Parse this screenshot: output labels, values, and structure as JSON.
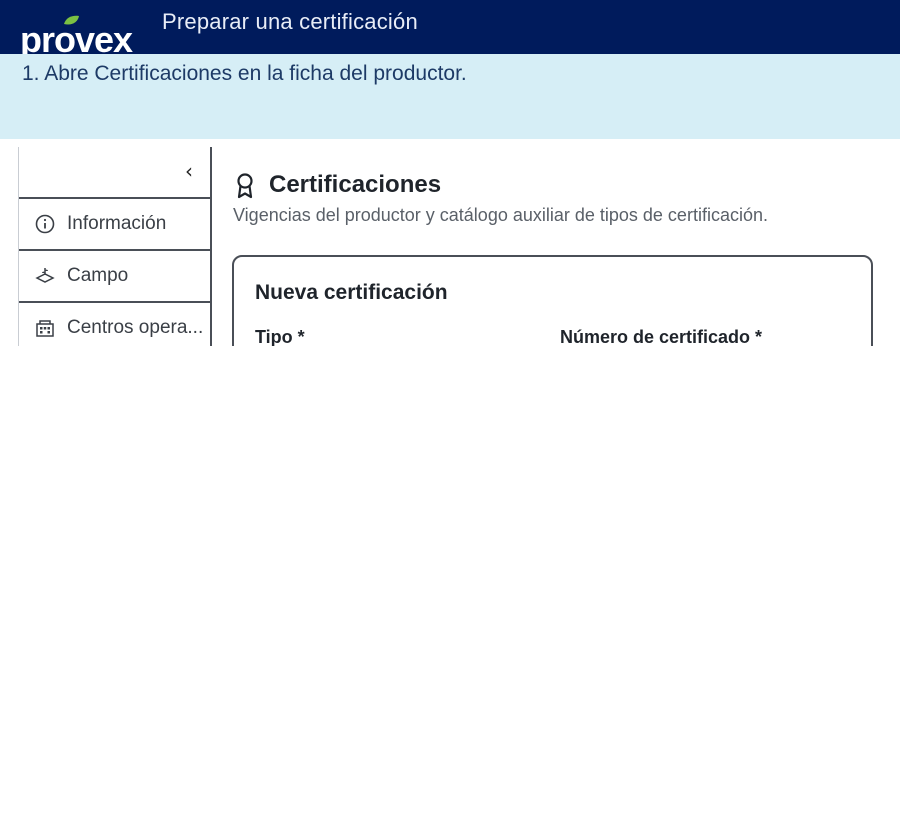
{
  "header": {
    "brand": "provex",
    "title": "Preparar una certificación",
    "colors": {
      "bar": "#001b5c",
      "leaf": "#7bc143"
    }
  },
  "step": {
    "text": "1. Abre Certificaciones en la ficha del productor.",
    "band_color": "#d6eef6"
  },
  "screenshot": {
    "sidebar": {
      "collapse_icon": "chevron-left-icon",
      "items": [
        {
          "label": "Información",
          "icon": "info-icon"
        },
        {
          "label": "Campo",
          "icon": "field-icon"
        },
        {
          "label": "Centros opera...",
          "icon": "building-icon"
        }
      ]
    },
    "section": {
      "icon": "award-icon",
      "title": "Certificaciones",
      "description": "Vigencias del productor y catálogo auxiliar de tipos de certificación."
    },
    "form": {
      "title": "Nueva certificación",
      "fields": [
        {
          "label": "Tipo *"
        },
        {
          "label": "Número de certificado *"
        }
      ]
    }
  }
}
